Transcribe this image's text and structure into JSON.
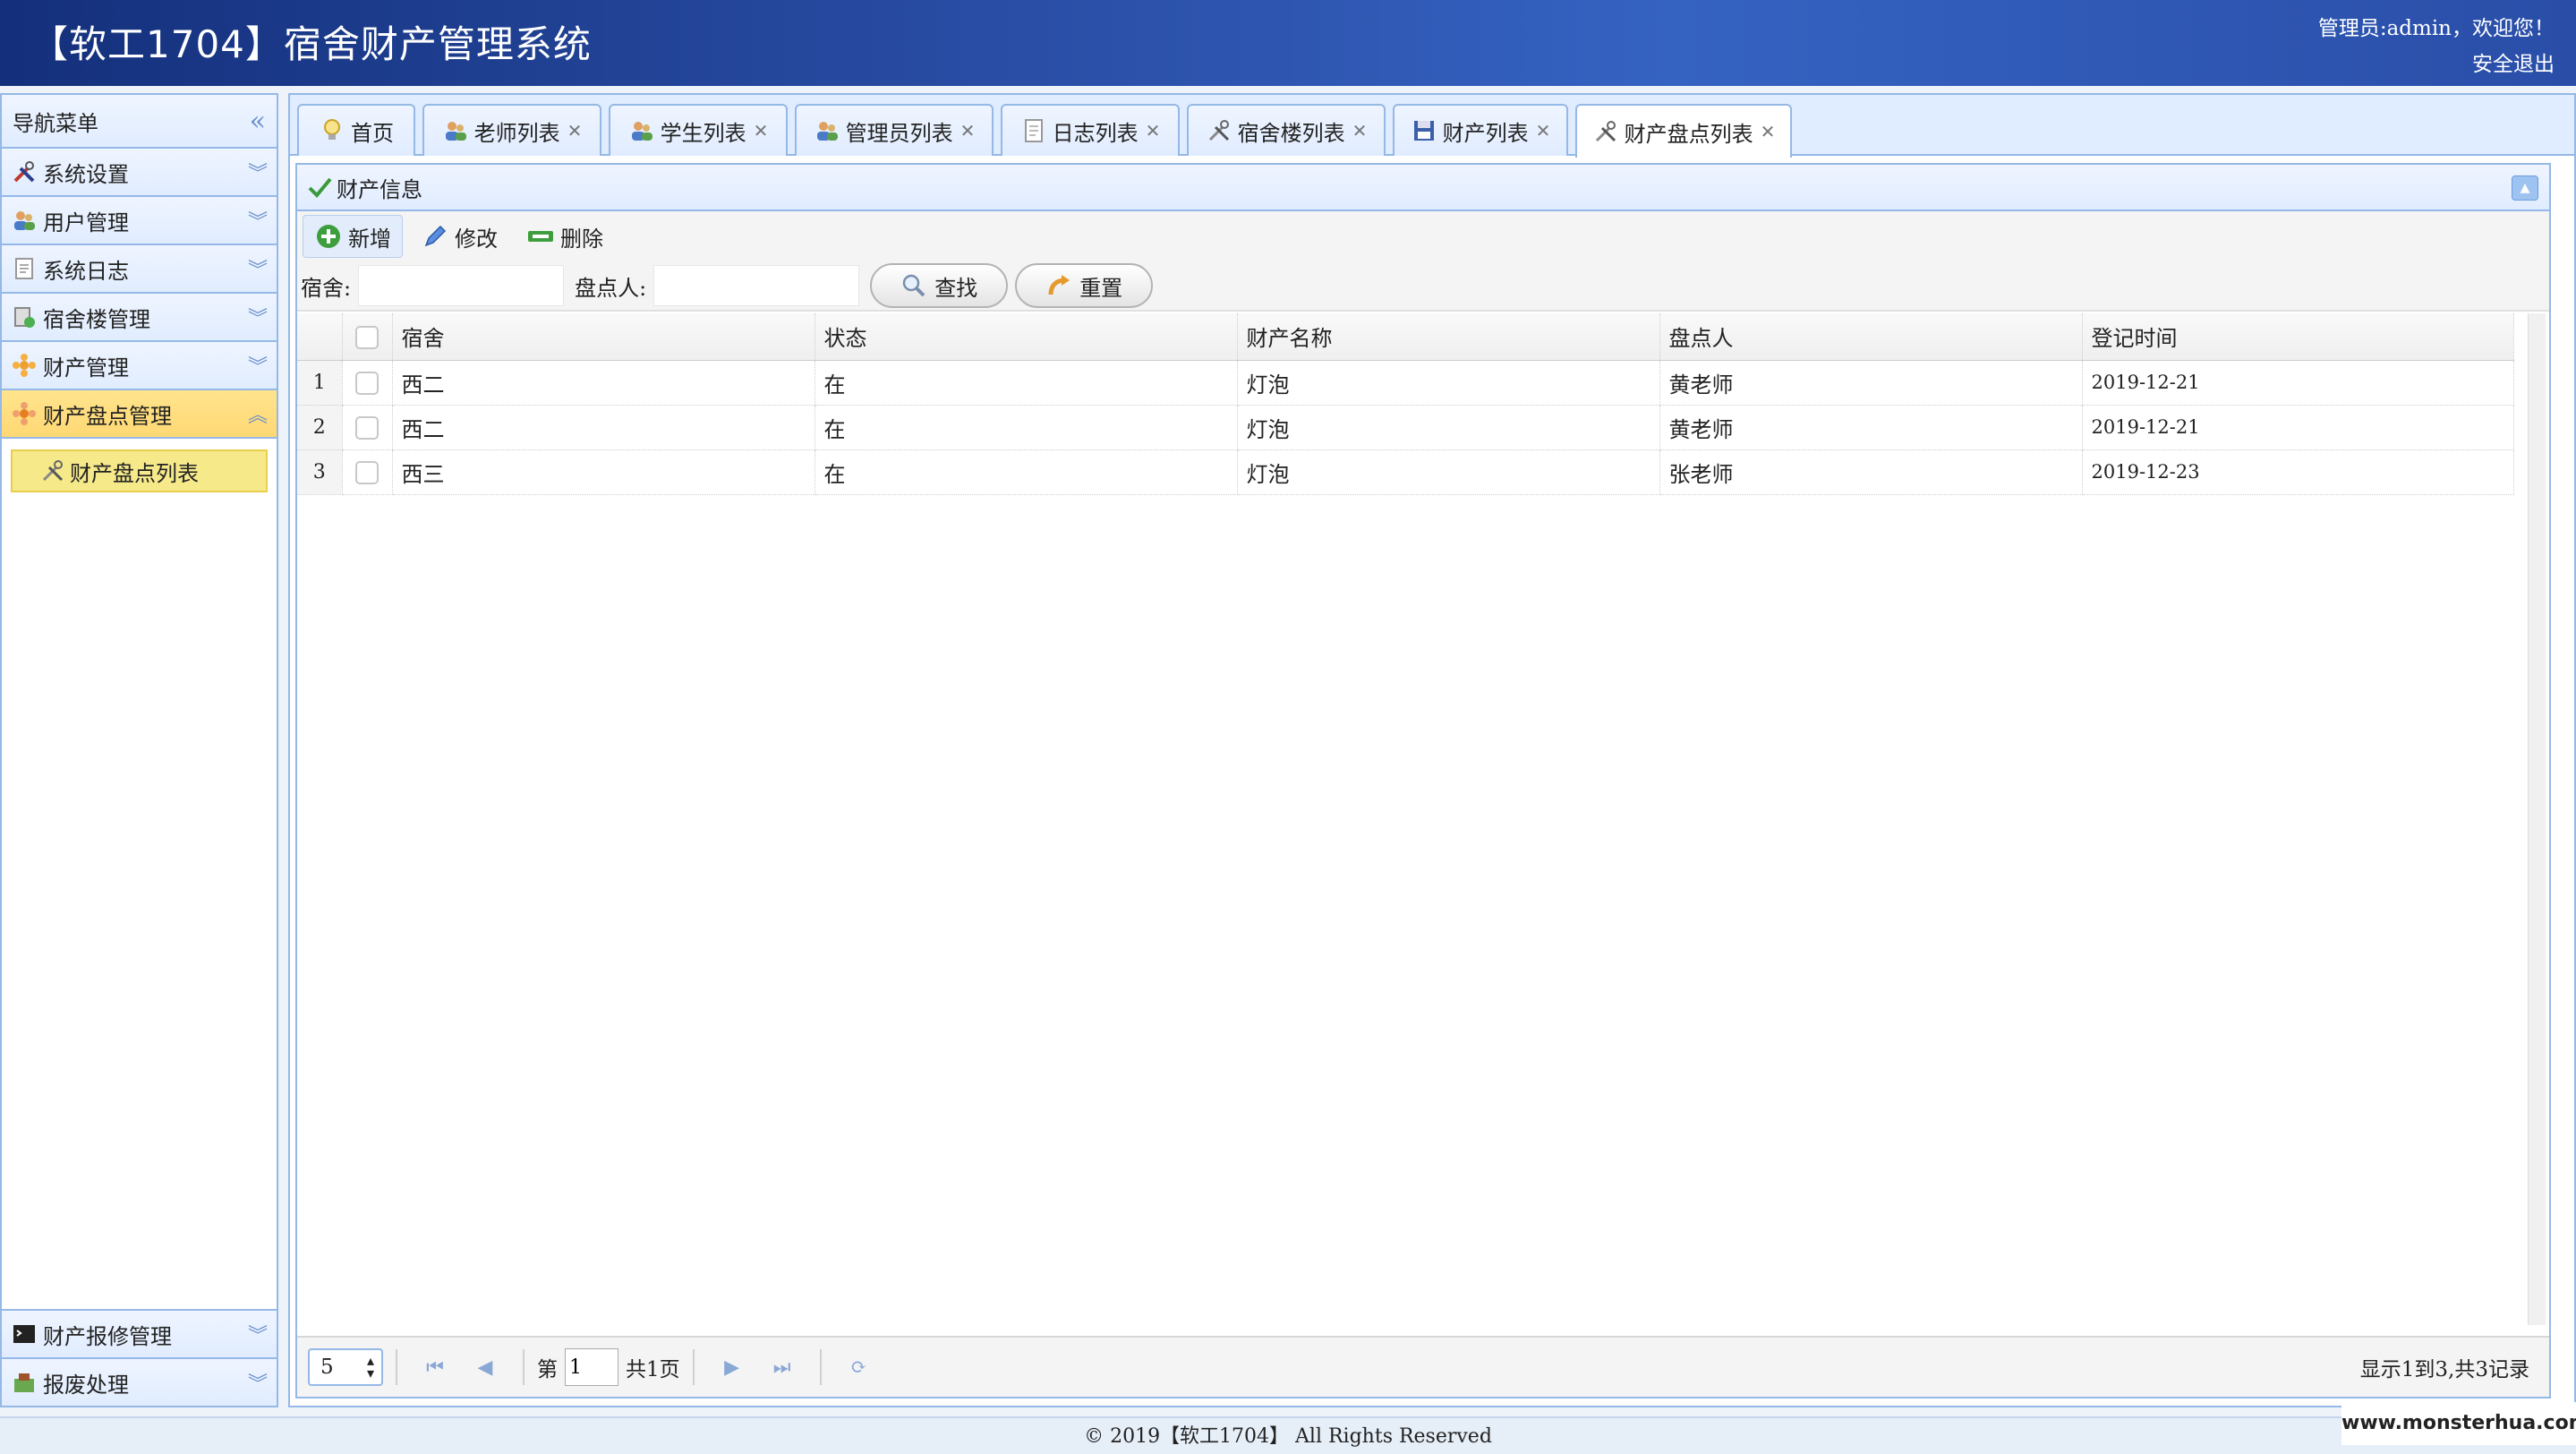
{
  "header": {
    "title": "【软工1704】宿舍财产管理系统",
    "greeting": "管理员:admin，欢迎您！",
    "logout": "安全退出"
  },
  "sidebar": {
    "title": "导航菜单",
    "items": [
      {
        "label": "系统设置",
        "icon": "tools-icon"
      },
      {
        "label": "用户管理",
        "icon": "users-icon"
      },
      {
        "label": "系统日志",
        "icon": "log-icon"
      },
      {
        "label": "宿舍楼管理",
        "icon": "building-icon"
      },
      {
        "label": "财产管理",
        "icon": "asset-icon"
      },
      {
        "label": "财产盘点管理",
        "icon": "inventory-icon"
      }
    ],
    "sub_items": [
      {
        "label": "财产盘点列表",
        "icon": "tools-icon"
      }
    ],
    "bottom_items": [
      {
        "label": "财产报修管理",
        "icon": "terminal-icon"
      },
      {
        "label": "报废处理",
        "icon": "disposal-icon"
      }
    ]
  },
  "tabs": [
    {
      "label": "首页",
      "icon": "bulb-icon"
    },
    {
      "label": "老师列表",
      "icon": "users-icon"
    },
    {
      "label": "学生列表",
      "icon": "users-icon"
    },
    {
      "label": "管理员列表",
      "icon": "users-icon"
    },
    {
      "label": "日志列表",
      "icon": "document-icon"
    },
    {
      "label": "宿舍楼列表",
      "icon": "tools-icon"
    },
    {
      "label": "财产列表",
      "icon": "save-icon"
    },
    {
      "label": "财产盘点列表",
      "icon": "tools-icon"
    }
  ],
  "panel": {
    "title": "财产信息"
  },
  "toolbar": {
    "add": "新增",
    "edit": "修改",
    "delete": "删除"
  },
  "search": {
    "dorm_label": "宿舍:",
    "dorm_value": "",
    "checker_label": "盘点人:",
    "checker_value": "",
    "find": "查找",
    "reset": "重置"
  },
  "table": {
    "columns": [
      "宿舍",
      "状态",
      "财产名称",
      "盘点人",
      "登记时间"
    ],
    "rows": [
      {
        "num": "1",
        "dorm": "西二",
        "status": "在",
        "asset": "灯泡",
        "checker": "黄老师",
        "date": "2019-12-21"
      },
      {
        "num": "2",
        "dorm": "西二",
        "status": "在",
        "asset": "灯泡",
        "checker": "黄老师",
        "date": "2019-12-21"
      },
      {
        "num": "3",
        "dorm": "西三",
        "status": "在",
        "asset": "灯泡",
        "checker": "张老师",
        "date": "2019-12-23"
      }
    ]
  },
  "pager": {
    "page_size": "5",
    "page_prefix": "第",
    "page_value": "1",
    "page_total": "共1页",
    "info": "显示1到3,共3记录"
  },
  "footer": {
    "text": "© 2019【软工1704】 All Rights Reserved"
  },
  "watermark": "www.monsterhua.com",
  "colors": {
    "header_bg": "#2a4ea6",
    "panel_border": "#95b8e7",
    "active_menu": "#ffd873",
    "selected_sub": "#f5e98a"
  }
}
